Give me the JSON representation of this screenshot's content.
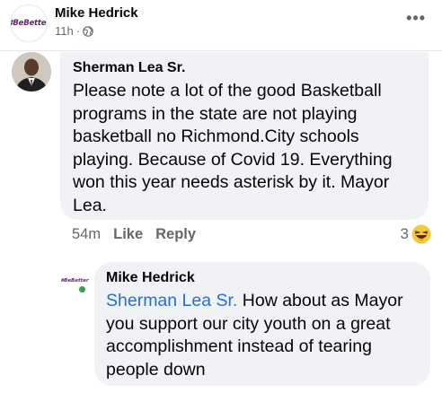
{
  "post": {
    "author": "Mike Hedrick",
    "page_logo": "#BeBetter",
    "time": "11h",
    "separator": "·",
    "privacy_icon": "globe-icon",
    "more_label": "•••"
  },
  "comment": {
    "author": "Sherman Lea Sr.",
    "text": "Please note a lot of the good Basketball programs in the state are not playing basketball no Richmond.City schools playing. Because of Covid 19. Everything won this year needs asterisk by it. Mayor Lea.",
    "time": "54m",
    "like_label": "Like",
    "reply_label": "Reply",
    "reaction_count": "3",
    "reaction_icon": "haha-emoji-icon"
  },
  "reply": {
    "author": "Mike Hedrick",
    "page_logo": "#BeBetter",
    "mention": "Sherman Lea Sr.",
    "text": " How about as Mayor you support our city youth on a great accomplishment instead of tearing people down"
  },
  "colors": {
    "mention": "#216fdb",
    "bubble": "#f0f2f5",
    "muted": "#65676b",
    "online": "#31a24c",
    "logo": "#6b1f7a"
  }
}
